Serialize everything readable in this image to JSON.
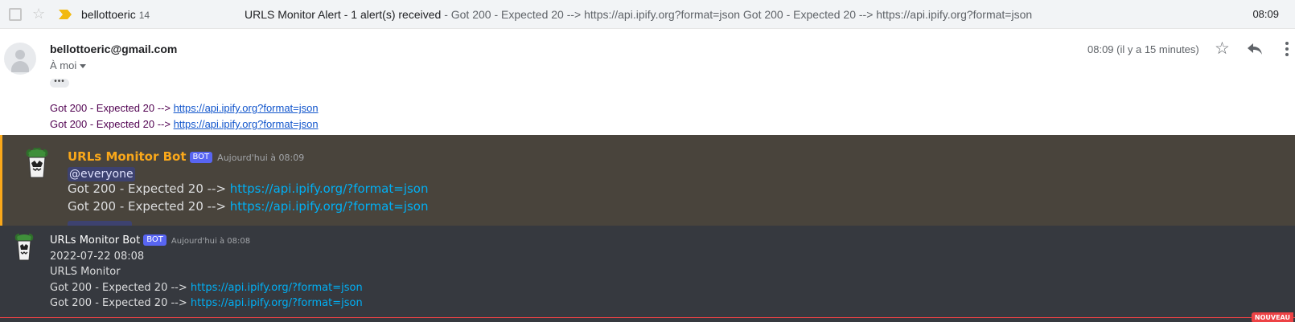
{
  "gmail": {
    "list_row": {
      "sender": "bellottoeric",
      "count": "14",
      "subject": "URLS Monitor Alert - 1 alert(s) received",
      "snippet": " - Got 200 - Expected 20 --> https://api.ipify.org?format=json Got 200 - Expected 20 --> https://api.ipify.org?format=json",
      "time": "08:09"
    },
    "email": {
      "from": "bellottoeric@gmail.com",
      "to": "À moi",
      "date": "08:09 (il y a 15 minutes)",
      "dots": "•••",
      "lines": [
        {
          "prefix": "Got 200 - Expected 20 --> ",
          "link": "https://api.ipify.org?format=json"
        },
        {
          "prefix": "Got 200 - Expected 20 --> ",
          "link": "https://api.ipify.org?format=json"
        }
      ]
    }
  },
  "discord": {
    "msg1": {
      "author": "URLs Monitor Bot",
      "tag": "BOT",
      "time": "Aujourd'hui à 08:09",
      "mention": "@everyone",
      "lines": [
        {
          "prefix": "Got 200 - Expected 20 --> ",
          "link": "https://api.ipify.org/?format=json"
        },
        {
          "prefix": "Got 200 - Expected 20 --> ",
          "link": "https://api.ipify.org/?format=json"
        }
      ]
    },
    "msg2": {
      "author": "URLs Monitor Bot",
      "tag": "BOT",
      "time": "Aujourd'hui à 08:08",
      "date_line": "2022-07-22 08:08",
      "title_line": "URLS Monitor",
      "lines": [
        {
          "prefix": "Got 200 - Expected 20 --> ",
          "link": "https://api.ipify.org/?format=json"
        },
        {
          "prefix": "Got 200 - Expected 20 --> ",
          "link": "https://api.ipify.org/?format=json"
        }
      ]
    },
    "new_label": "NOUVEAU"
  },
  "colors": {
    "gmail_row_bg": "#f2f4f6",
    "importance_marker": "#f2b90f",
    "link": "#1155cc",
    "discord_bg": "#36393f",
    "discord_highlight": "#49443c",
    "mention_accent": "#faa81a",
    "discord_link": "#00aff4",
    "bot_tag": "#5865f2",
    "new_line": "#ed4245"
  },
  "icons": [
    "checkbox-icon",
    "star-icon",
    "importance-marker-icon",
    "avatar-icon",
    "caret-down-icon",
    "reply-icon",
    "more-vert-icon",
    "bot-avatar-icon"
  ]
}
